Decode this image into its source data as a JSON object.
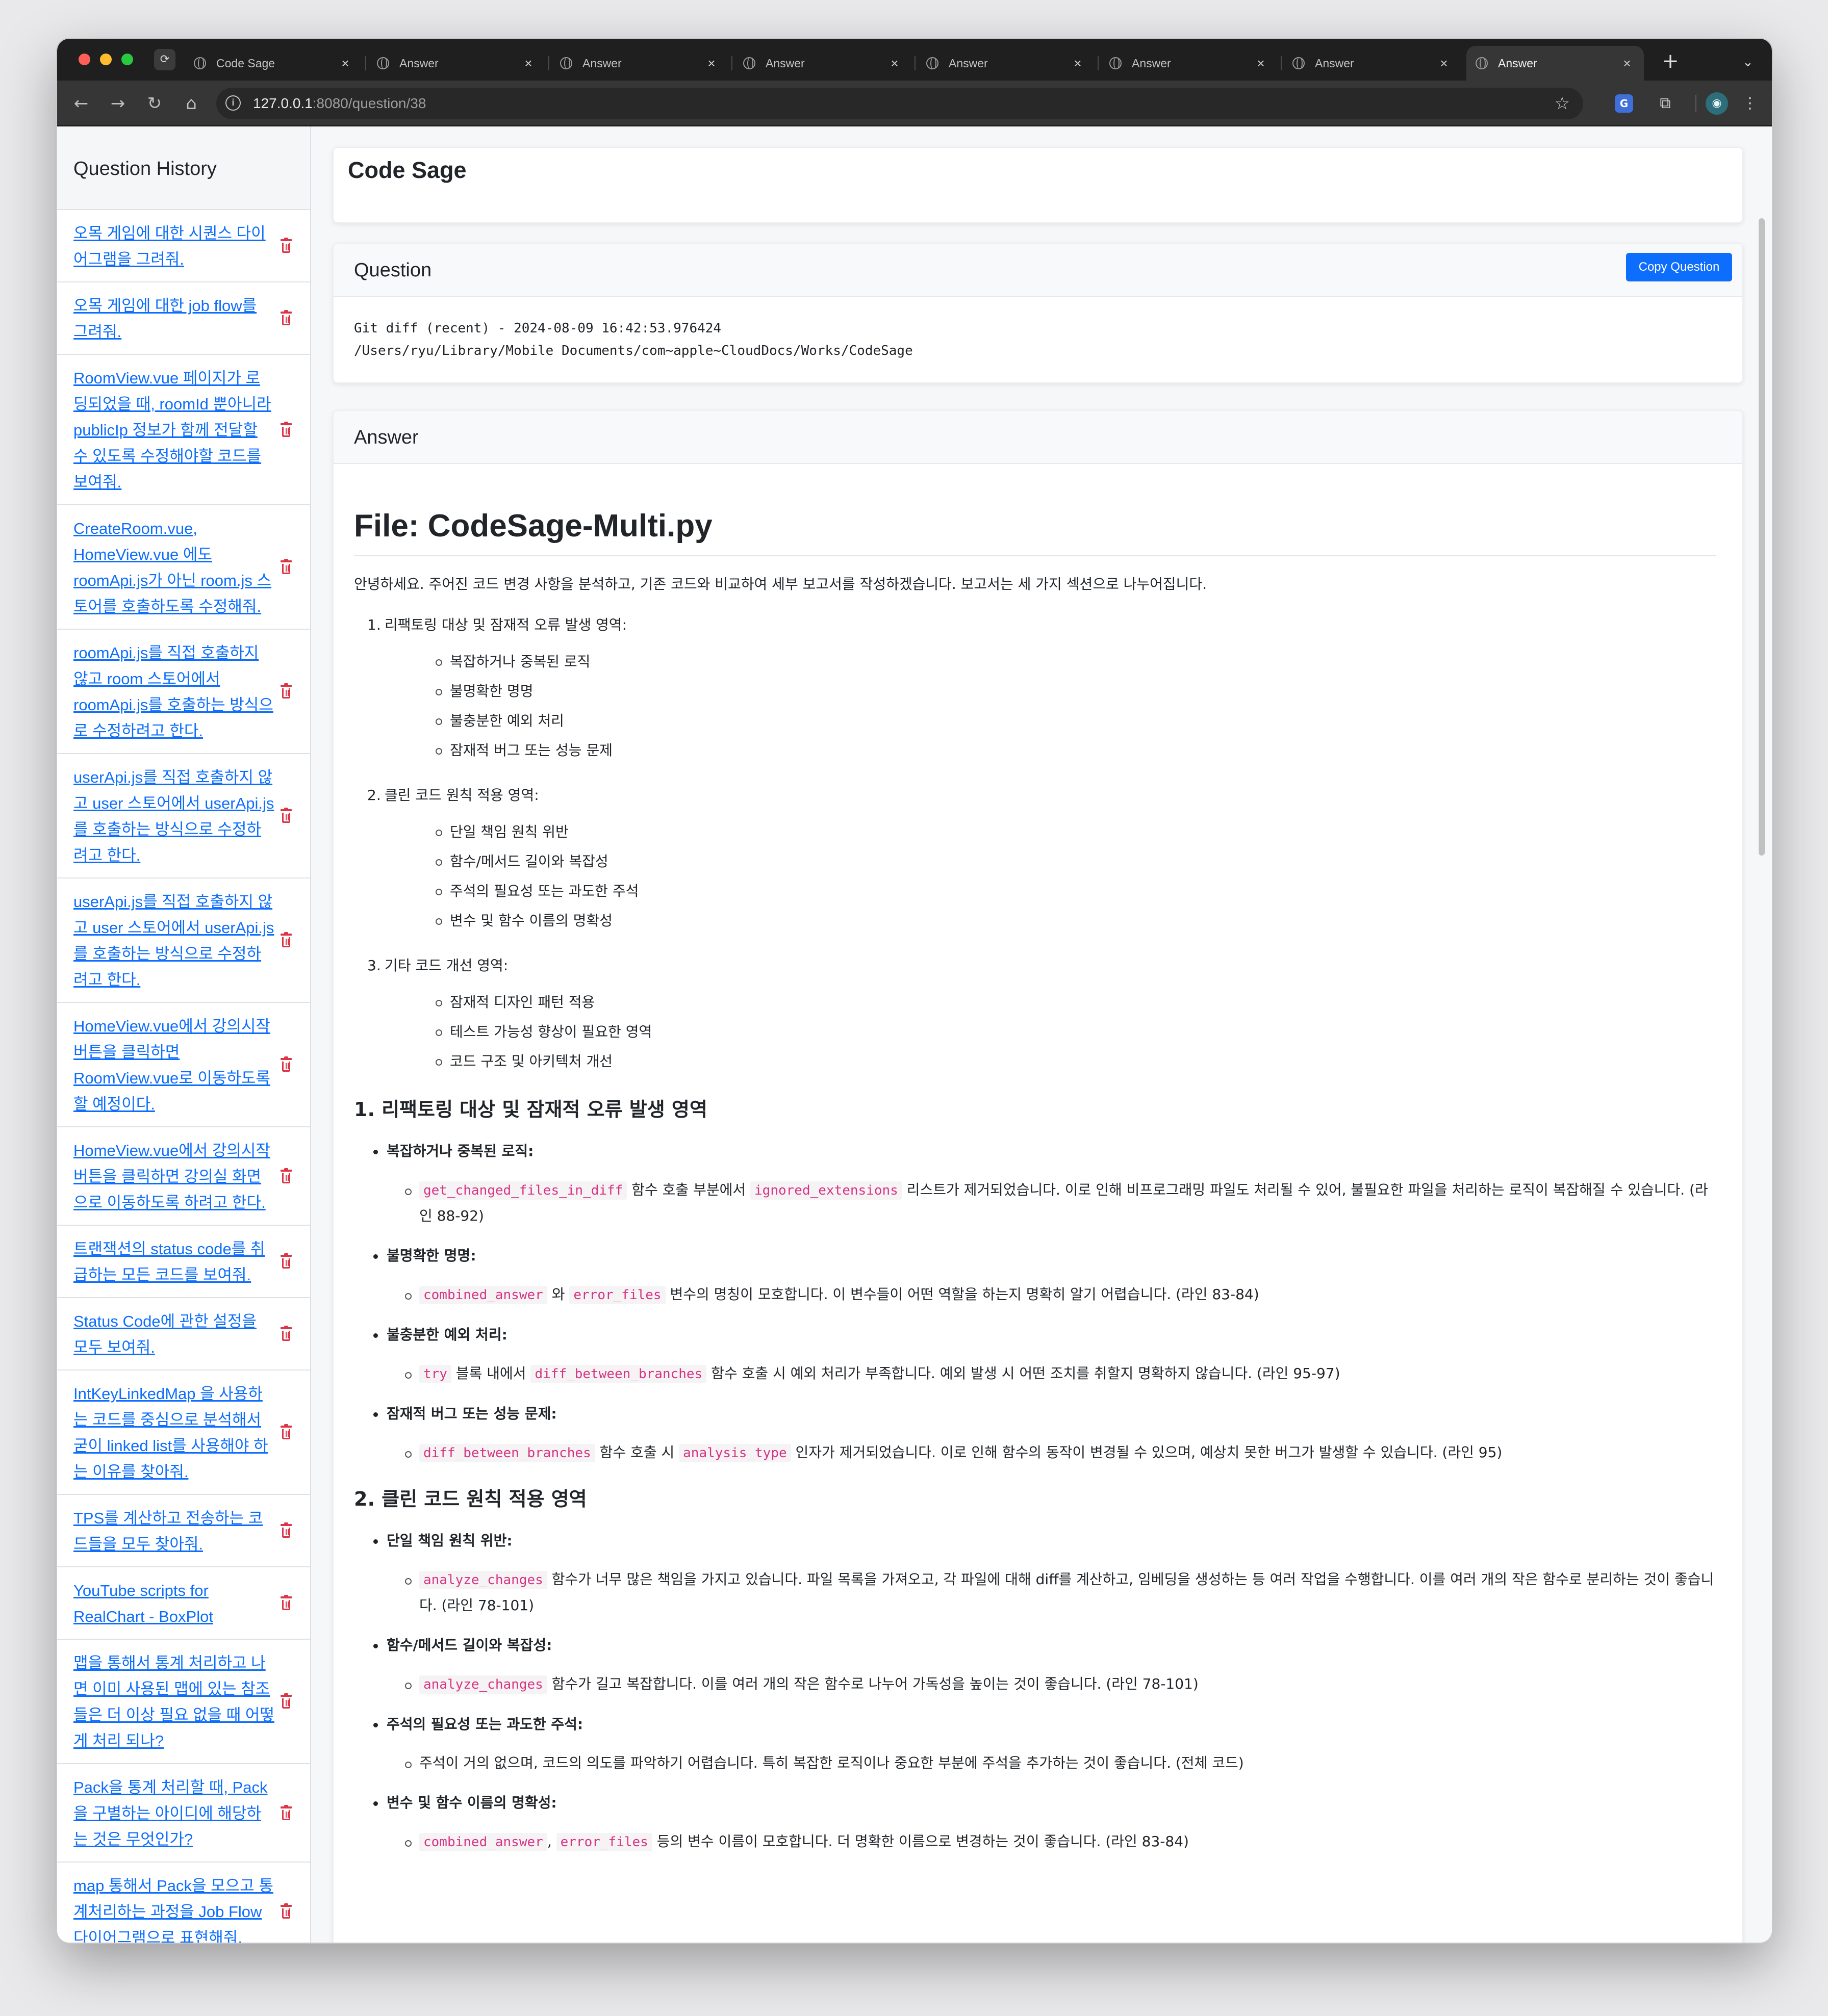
{
  "browser": {
    "tabs": [
      {
        "title": "Code Sage",
        "active": false
      },
      {
        "title": "Answer",
        "active": false
      },
      {
        "title": "Answer",
        "active": false
      },
      {
        "title": "Answer",
        "active": false
      },
      {
        "title": "Answer",
        "active": false
      },
      {
        "title": "Answer",
        "active": false
      },
      {
        "title": "Answer",
        "active": false
      },
      {
        "title": "Answer",
        "active": true
      }
    ],
    "url_host": "127.0.0.1",
    "url_rest": ":8080/question/38",
    "accent_color": "#0d6efd"
  },
  "sidebar": {
    "title": "Question History",
    "items": [
      "오목 게임에 대한 시퀀스 다이어그램을 그려줘.",
      "오목 게임에 대한 job flow를 그려줘.",
      "RoomView.vue 페이지가 로딩되었을 때, roomId 뿐아니라 publicIp 정보가 함께 전달할 수 있도록 수정해야할 코드를 보여줘.",
      "CreateRoom.vue, HomeView.vue 에도 roomApi.js가 아닌 room.js 스토어를 호출하도록 수정해줘.",
      "roomApi.js를 직접 호출하지 않고 room 스토어에서 roomApi.js를 호출하는 방식으로 수정하려고 한다.",
      "userApi.js를 직접 호출하지 않고 user 스토어에서 userApi.js를 호출하는 방식으로 수정하려고 한다.",
      "userApi.js를 직접 호출하지 않고 user 스토어에서 userApi.js를 호출하는 방식으로 수정하려고 한다.",
      "HomeView.vue에서 강의시작 버튼을 클릭하면 RoomView.vue로 이동하도록 할 예정이다.",
      "HomeView.vue에서 강의시작 버튼을 클릭하면 강의실 화면으로 이동하도록 하려고 한다.",
      "트랜잭션의 status code를 취급하는 모든 코드를 보여줘.",
      "Status Code에 관한 설정을 모두 보여줘.",
      "IntKeyLinkedMap 을 사용하는 코드를 중심으로 분석해서 굳이 linked list를 사용해야 하는 이유를 찾아줘.",
      "TPS를 계산하고 전송하는 코드들을 모두 찾아줘.",
      "YouTube scripts for RealChart - BoxPlot",
      "맵을 통해서 통계 처리하고 나면 이미 사용된 맵에 있는 참조들은 더 이상 필요 없을 때 어떻게 처리 되나?",
      "Pack을 통계 처리할 때, Pack을 구별하는 아이디에 해당하는 것은 무엇인가?",
      "map 통해서 Pack을 모으고 통계처리하는 과정을 Job Flow 다이어그램으로 표현해줘.",
      "map 통해서 Pack을 모으고 통"
    ]
  },
  "page": {
    "title": "Code Sage",
    "question_heading": "Question",
    "copy_label": "Copy Question",
    "question_line1": "Git diff (recent) - 2024-08-09 16:42:53.976424",
    "question_line2": "/Users/ryu/Library/Mobile Documents/com~apple~CloudDocs/Works/CodeSage",
    "answer_heading": "Answer"
  },
  "answer": {
    "file_title": "File: CodeSage-Multi.py",
    "intro": "안녕하세요. 주어진 코드 변경 사항을 분석하고, 기존 코드와 비교하여 세부 보고서를 작성하겠습니다. 보고서는 세 가지 섹션으로 나누어집니다.",
    "outline": [
      {
        "num": "1.",
        "title": "리팩토링 대상 및 잠재적 오류 발생 영역:",
        "items": [
          "복잡하거나 중복된 로직",
          "불명확한 명명",
          "불충분한 예외 처리",
          "잠재적 버그 또는 성능 문제"
        ]
      },
      {
        "num": "2.",
        "title": "클린 코드 원칙 적용 영역:",
        "items": [
          "단일 책임 원칙 위반",
          "함수/메서드 길이와 복잡성",
          "주석의 필요성 또는 과도한 주석",
          "변수 및 함수 이름의 명확성"
        ]
      },
      {
        "num": "3.",
        "title": "기타 코드 개선 영역:",
        "items": [
          "잠재적 디자인 패턴 적용",
          "테스트 가능성 향상이 필요한 영역",
          "코드 구조 및 아키텍처 개선"
        ]
      }
    ],
    "section1": {
      "heading": "1. 리팩토링 대상 및 잠재적 오류 발생 영역",
      "items": [
        {
          "label": "복잡하거나 중복된 로직",
          "colon": ":",
          "code1": "get_changed_files_in_diff",
          "t1": " 함수 호출 부분에서 ",
          "code2": "ignored_extensions",
          "t2": " 리스트가 제거되었습니다. 이로 인해 비프로그래밍 파일도 처리될 수 있어, 불필요한 파일을 처리하는 로직이 복잡해질 수 있습니다. (라인 88-92)"
        },
        {
          "label": "불명확한 명명",
          "colon": ":",
          "code1": "combined_answer",
          "t1": " 와 ",
          "code2": "error_files",
          "t2": " 변수의 명칭이 모호합니다. 이 변수들이 어떤 역할을 하는지 명확히 알기 어렵습니다. (라인 83-84)"
        },
        {
          "label": "불충분한 예외 처리",
          "colon": ":",
          "code1": "try",
          "t1": " 블록 내에서 ",
          "code2": "diff_between_branches",
          "t2": " 함수 호출 시 예외 처리가 부족합니다. 예외 발생 시 어떤 조치를 취할지 명확하지 않습니다. (라인 95-97)"
        },
        {
          "label": "잠재적 버그 또는 성능 문제",
          "colon": ":",
          "code1": "diff_between_branches",
          "t1": " 함수 호출 시 ",
          "code2": "analysis_type",
          "t2": " 인자가 제거되었습니다. 이로 인해 함수의 동작이 변경될 수 있으며, 예상치 못한 버그가 발생할 수 있습니다. (라인 95)"
        }
      ]
    },
    "section2": {
      "heading": "2. 클린 코드 원칙 적용 영역",
      "items": [
        {
          "label": "단일 책임 원칙 위반",
          "colon": ":",
          "code1": "analyze_changes",
          "t1": " 함수가 너무 많은 책임을 가지고 있습니다. 파일 목록을 가져오고, 각 파일에 대해 diff를 계산하고, 임베딩을 생성하는 등 여러 작업을 수행합니다. 이를 여러 개의 작은 함수로 분리하는 것이 좋습니다. (라인 78-101)",
          "code2": "",
          "t2": ""
        },
        {
          "label": "함수/메서드 길이와 복잡성",
          "colon": ":",
          "code1": "analyze_changes",
          "t1": " 함수가 길고 복잡합니다. 이를 여러 개의 작은 함수로 나누어 가독성을 높이는 것이 좋습니다. (라인 78-101)",
          "code2": "",
          "t2": ""
        },
        {
          "label": "주석의 필요성 또는 과도한 주석",
          "colon": ":",
          "code1": "",
          "t1": "주석이 거의 없으며, 코드의 의도를 파악하기 어렵습니다. 특히 복잡한 로직이나 중요한 부분에 주석을 추가하는 것이 좋습니다. (전체 코드)",
          "code2": "",
          "t2": ""
        },
        {
          "label": "변수 및 함수 이름의 명확성",
          "colon": ":",
          "code1": "combined_answer",
          "t1": ", ",
          "code2": "error_files",
          "t2": " 등의 변수 이름이 모호합니다. 더 명확한 이름으로 변경하는 것이 좋습니다. (라인 83-84)"
        }
      ]
    }
  }
}
